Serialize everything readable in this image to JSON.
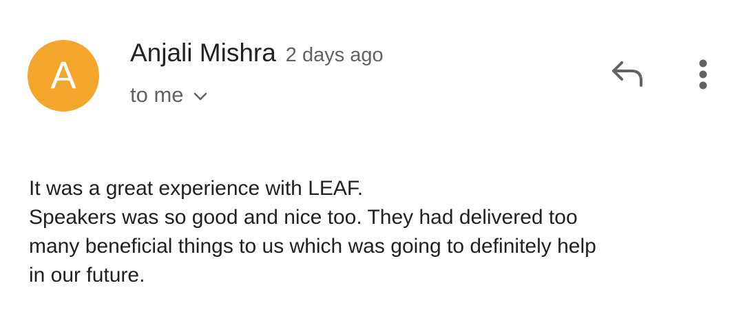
{
  "message": {
    "sender": {
      "initial": "A",
      "name": "Anjali Mishra",
      "avatar_color": "#f4a52b"
    },
    "time": "2 days ago",
    "recipient_label": "to me",
    "recipient_toggle_icon": "chevron-down-icon",
    "actions": {
      "reply_icon": "reply-icon",
      "more_icon": "more-vertical-icon"
    },
    "body_lines": [
      "It was a great experience with LEAF.",
      "Speakers was so good and nice too. They had delivered too",
      "many beneficial things to us which was going to definitely help",
      "in our future."
    ]
  },
  "colors": {
    "primary_text": "#202124",
    "secondary_text": "#5f6368",
    "icon": "#5f6368",
    "background": "#ffffff"
  }
}
